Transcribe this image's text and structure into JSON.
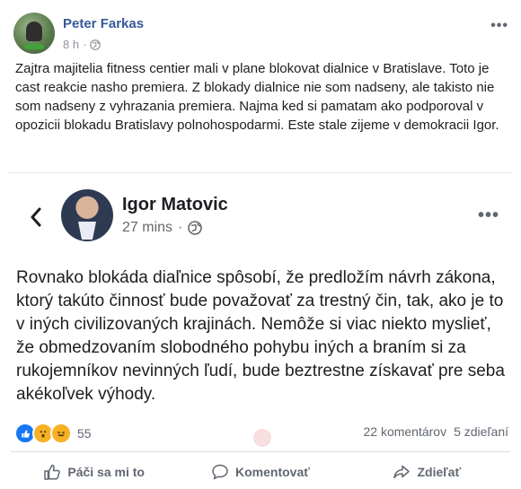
{
  "post": {
    "author": "Peter Farkas",
    "time": "8 h",
    "text": "Zajtra majitelia fitness centier mali v plane blokovat dialnice v Bratislave. Toto je cast reakcie nasho premiera. Z blokady dialnice nie som nadseny, ale takisto nie som nadseny z vyhrazania premiera. Najma ked si pamatam ako podporoval v opozicii blokadu Bratislavy polnohospodarmi. Este stale zijeme v demokracii Igor."
  },
  "shared": {
    "author": "Igor Matovic",
    "time": "27 mins",
    "text": "Rovnako blokáda diaľnice spôsobí, že predložím návrh zákona, ktorý takúto činnosť bude považovať za trestný čin, tak, ako je to v iných civilizovaných krajinách. Nemôže si viac niekto myslieť, že obmedzovaním slobodného pohybu iných a braním si za rukojemníkov nevinných ľudí, bude beztrestne získavať pre seba akékoľvek výhody."
  },
  "reactions": {
    "count": "55",
    "icons": [
      "like-reaction-icon",
      "wow-reaction-icon",
      "haha-reaction-icon"
    ],
    "comments": "22 komentárov",
    "shares": "5 zdieľaní"
  },
  "actions": {
    "like": "Páči sa mi to",
    "comment": "Komentovať",
    "share": "Zdieľať"
  },
  "colors": {
    "author_link": "#385898",
    "like_blue": "#1877f2",
    "reaction_yellow": "#f7b125"
  }
}
